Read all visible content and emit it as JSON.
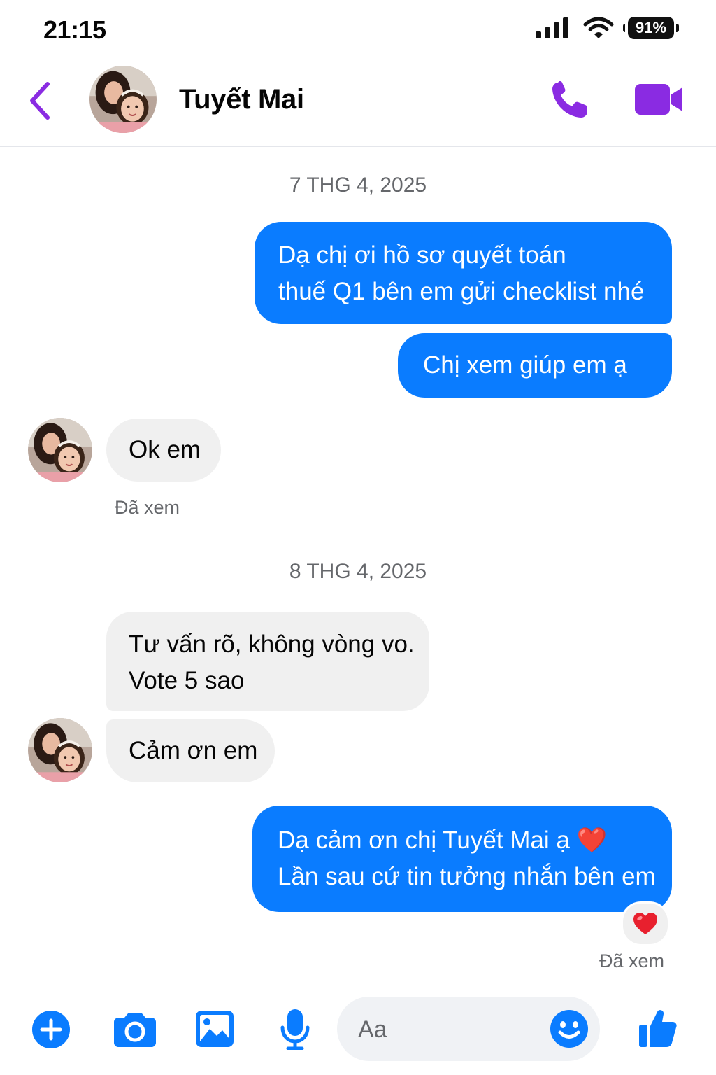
{
  "status_bar": {
    "time": "21:15",
    "battery": "91%"
  },
  "header": {
    "contact_name": "Tuyết Mai",
    "back_icon": "chevron-left-icon",
    "call_icon": "phone-icon",
    "video_icon": "video-camera-icon",
    "accent_color": "#8a2be2"
  },
  "chat": {
    "date_separator_1": "7 THG 4, 2025",
    "date_separator_2": "8 THG 4, 2025",
    "messages": [
      {
        "from": "me",
        "lines": [
          "Dạ chị ơi hồ sơ quyết toán",
          "thuế Q1 bên em gửi checklist nhé"
        ]
      },
      {
        "from": "me",
        "lines": [
          "Chị xem giúp em ạ"
        ]
      },
      {
        "from": "contact",
        "lines": [
          "Ok em"
        ]
      },
      {
        "from": "contact",
        "lines": [
          "Tư vấn rõ, không vòng vo.",
          "Vote 5 sao"
        ]
      },
      {
        "from": "contact",
        "lines": [
          "Cảm ơn em"
        ]
      },
      {
        "from": "me",
        "lines": [
          "Dạ cảm ơn chị Tuyết Mai ạ ❤️",
          "Lần sau cứ tin tưởng nhắn bên em"
        ]
      }
    ],
    "seen_label_1": "Đã xem",
    "seen_label_2": "Đã xem",
    "reaction": "❤️",
    "outgoing_color": "#0a7cff",
    "incoming_color": "#f0f0f0"
  },
  "composer": {
    "placeholder": "Aa",
    "icons": [
      "plus-icon",
      "camera-icon",
      "image-icon",
      "microphone-icon",
      "emoji-icon",
      "thumbs-up-icon"
    ],
    "icon_color": "#0a7cff"
  }
}
